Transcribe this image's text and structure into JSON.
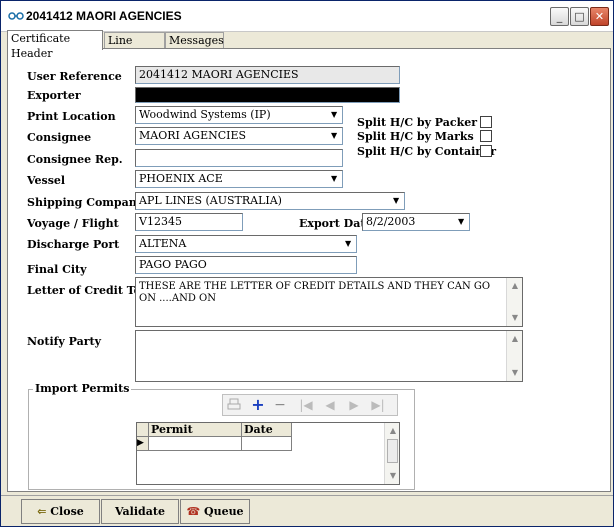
{
  "window": {
    "title": "2041412 MAORI AGENCIES",
    "minimize": "_",
    "maximize": "□",
    "close": "✕"
  },
  "tabs": [
    {
      "label": "Certificate Header"
    },
    {
      "label": "Line Items"
    },
    {
      "label": "Messages"
    }
  ],
  "form": {
    "user_reference": {
      "label": "User Reference",
      "value": "2041412 MAORI AGENCIES"
    },
    "exporter": {
      "label": "Exporter",
      "value": ""
    },
    "print_location": {
      "label": "Print Location",
      "value": "Woodwind Systems (IP)"
    },
    "consignee": {
      "label": "Consignee",
      "value": "MAORI AGENCIES"
    },
    "consignee_rep": {
      "label": "Consignee Rep.",
      "value": ""
    },
    "vessel": {
      "label": "Vessel",
      "value": "PHOENIX ACE"
    },
    "shipping_company": {
      "label": "Shipping Company",
      "value": "APL LINES (AUSTRALIA)"
    },
    "voyage_flight": {
      "label": "Voyage / Flight",
      "value": "V12345"
    },
    "export_date": {
      "label": "Export Date",
      "value": "8/2/2003"
    },
    "discharge_port": {
      "label": "Discharge Port",
      "value": "ALTENA"
    },
    "final_city": {
      "label": "Final City",
      "value": "PAGO PAGO"
    },
    "letter_of_credit": {
      "label": "Letter of Credit Text",
      "value": "THESE ARE THE LETTER OF CREDIT DETAILS AND THEY CAN GO ON  ....AND ON"
    },
    "notify_party": {
      "label": "Notify Party",
      "value": ""
    },
    "split_packer": {
      "label": "Split H/C by Packer",
      "checked": false
    },
    "split_marks": {
      "label": "Split H/C by Marks",
      "checked": false
    },
    "split_container": {
      "label": "Split H/C by Container",
      "checked": false
    }
  },
  "import_permits": {
    "title": "Import Permits",
    "columns": [
      "Permit Number",
      "Date"
    ],
    "row_marker": "▶",
    "nav": {
      "plus": "+",
      "minus": "−",
      "first": "|◀",
      "prev": "◀",
      "next": "▶",
      "last": "▶|"
    }
  },
  "footer": {
    "close": "Close",
    "validate": "Validate",
    "queue": "Queue It"
  },
  "colors": {
    "window_bg": "#ece9d8",
    "panel_bg": "#ffffff",
    "readonly_bg": "#e8e8e8",
    "accent_blue": "#1a3fc0"
  }
}
